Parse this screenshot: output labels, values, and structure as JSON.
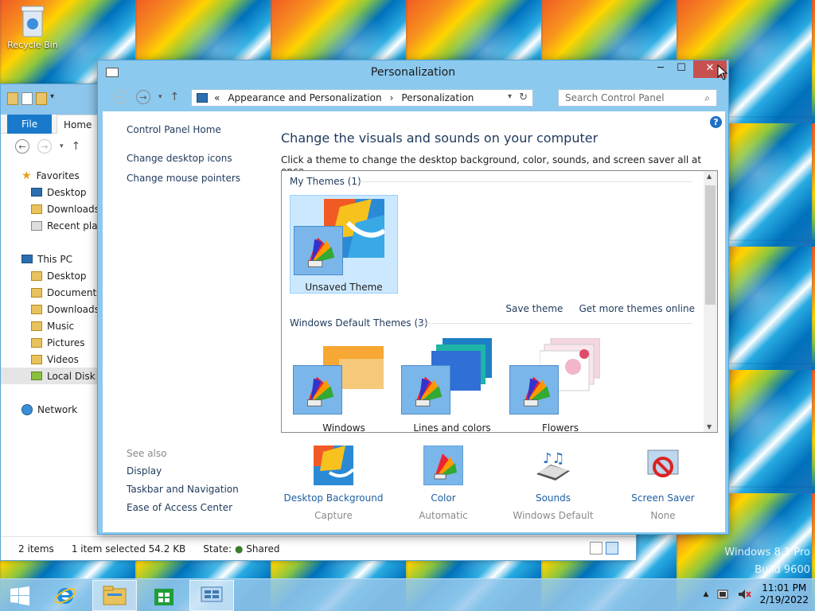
{
  "desktop": {
    "recycle_bin_label": "Recycle Bin",
    "watermark_line1": "Windows 8.1 Pro",
    "watermark_line2": "Build 9600"
  },
  "explorer": {
    "tabs": {
      "file": "File",
      "home": "Home"
    },
    "nav": [
      {
        "label": "Favorites",
        "level": 1,
        "icon": "star-icon"
      },
      {
        "label": "Desktop",
        "level": 2,
        "icon": "desktop-icon"
      },
      {
        "label": "Downloads",
        "level": 2,
        "icon": "folder-icon"
      },
      {
        "label": "Recent places",
        "level": 2,
        "icon": "recent-places-icon"
      },
      {
        "label": "This PC",
        "level": 1,
        "icon": "computer-icon"
      },
      {
        "label": "Desktop",
        "level": 2,
        "icon": "folder-icon"
      },
      {
        "label": "Documents",
        "level": 2,
        "icon": "folder-icon"
      },
      {
        "label": "Downloads",
        "level": 2,
        "icon": "folder-icon"
      },
      {
        "label": "Music",
        "level": 2,
        "icon": "folder-icon"
      },
      {
        "label": "Pictures",
        "level": 2,
        "icon": "folder-icon"
      },
      {
        "label": "Videos",
        "level": 2,
        "icon": "folder-icon"
      },
      {
        "label": "Local Disk (C:)",
        "level": 2,
        "icon": "drive-icon",
        "selected": true
      },
      {
        "label": "Network",
        "level": 1,
        "icon": "network-icon"
      }
    ],
    "status": {
      "items": "2 items",
      "selected": "1 item selected  54.2 KB",
      "state_label": "State:",
      "state_value": "Shared"
    }
  },
  "personalization": {
    "title": "Personalization",
    "address": {
      "prefix": "«",
      "crumb1": "Appearance and Personalization",
      "sep": "›",
      "crumb2": "Personalization"
    },
    "search_placeholder": "Search Control Panel",
    "side_links": {
      "home": "Control Panel Home",
      "desktop_icons": "Change desktop icons",
      "mouse_pointers": "Change mouse pointers"
    },
    "see_also": {
      "header": "See also",
      "display": "Display",
      "taskbar": "Taskbar and Navigation",
      "ease": "Ease of Access Center"
    },
    "heading": "Change the visuals and sounds on your computer",
    "subheading": "Click a theme to change the desktop background, color, sounds, and screen saver all at once.",
    "my_themes": {
      "header": "My Themes (1)",
      "items": [
        {
          "label": "Unsaved Theme",
          "selected": true
        }
      ]
    },
    "links": {
      "save_theme": "Save theme",
      "get_more": "Get more themes online"
    },
    "default_themes": {
      "header": "Windows Default Themes (3)",
      "items": [
        {
          "label": "Windows"
        },
        {
          "label": "Lines and colors"
        },
        {
          "label": "Flowers"
        }
      ]
    },
    "bottom": [
      {
        "name": "Desktop Background",
        "value": "Capture",
        "icon": "desktop-background-icon"
      },
      {
        "name": "Color",
        "value": "Automatic",
        "icon": "color-palette-icon"
      },
      {
        "name": "Sounds",
        "value": "Windows Default",
        "icon": "sounds-icon"
      },
      {
        "name": "Screen Saver",
        "value": "None",
        "icon": "screen-saver-icon"
      }
    ]
  },
  "taskbar": {
    "time": "11:01 PM",
    "date": "2/19/2022"
  }
}
